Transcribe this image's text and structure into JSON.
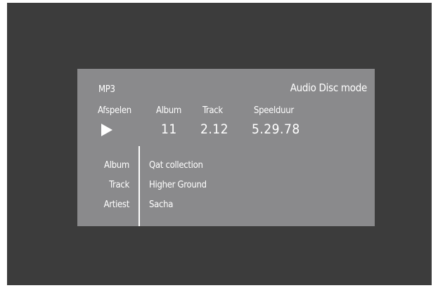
{
  "header": {
    "format": "MP3",
    "mode": "Audio Disc mode"
  },
  "status": {
    "play_label": "Afspelen",
    "album_label": "Album",
    "track_label": "Track",
    "duration_label": "Speelduur",
    "play_icon": "play-icon",
    "album_value": "11",
    "track_value": "2.12",
    "duration_value": "5.29.78"
  },
  "info": {
    "album_label": "Album",
    "track_label": "Track",
    "artist_label": "Artiest",
    "album_value": "Qat collection",
    "track_value": "Higher Ground",
    "artist_value": "Sacha"
  },
  "colors": {
    "outer_background": "#3c3c3c",
    "panel_background": "#8a8a8c",
    "text": "#ffffff"
  }
}
